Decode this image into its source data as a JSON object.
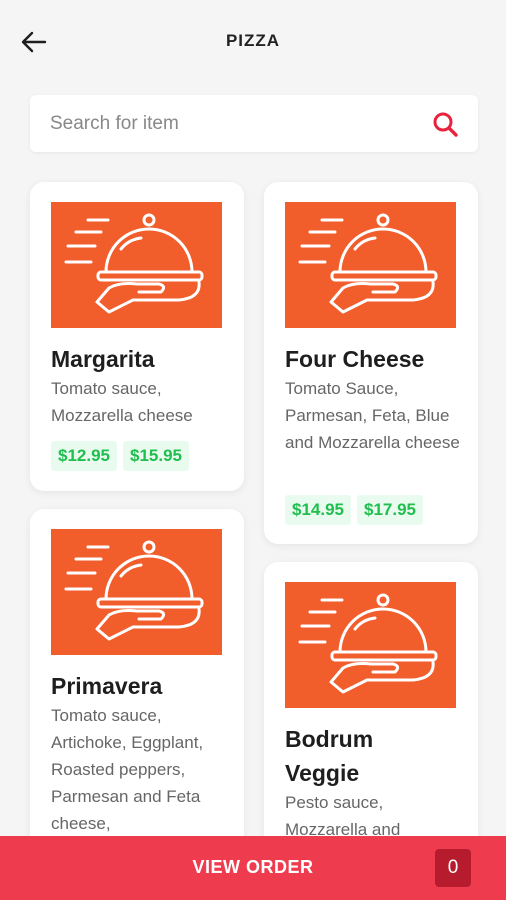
{
  "header": {
    "title": "PIZZA",
    "back_icon": "arrow-left-icon"
  },
  "search": {
    "placeholder": "Search for item",
    "value": "",
    "icon": "search-icon",
    "icon_color": "#e8233e"
  },
  "image_color": "#f25d2c",
  "items": [
    {
      "name": "Margarita",
      "description": "Tomato sauce, Mozzarella cheese",
      "prices": [
        "$12.95",
        "$15.95"
      ]
    },
    {
      "name": "Four Cheese",
      "description": "Tomato Sauce, Parmesan, Feta, Blue and Mozzarella cheese",
      "prices": [
        "$14.95",
        "$17.95"
      ]
    },
    {
      "name": "Primavera",
      "description": "Tomato sauce, Artichoke, Eggplant, Roasted peppers, Parmesan and Feta cheese,",
      "prices": []
    },
    {
      "name": "Bodrum Veggie",
      "description": "Pesto sauce, Mozzarella and",
      "prices": []
    }
  ],
  "bottom_bar": {
    "label": "VIEW ORDER",
    "count": "0",
    "color": "#ee3c4e"
  }
}
